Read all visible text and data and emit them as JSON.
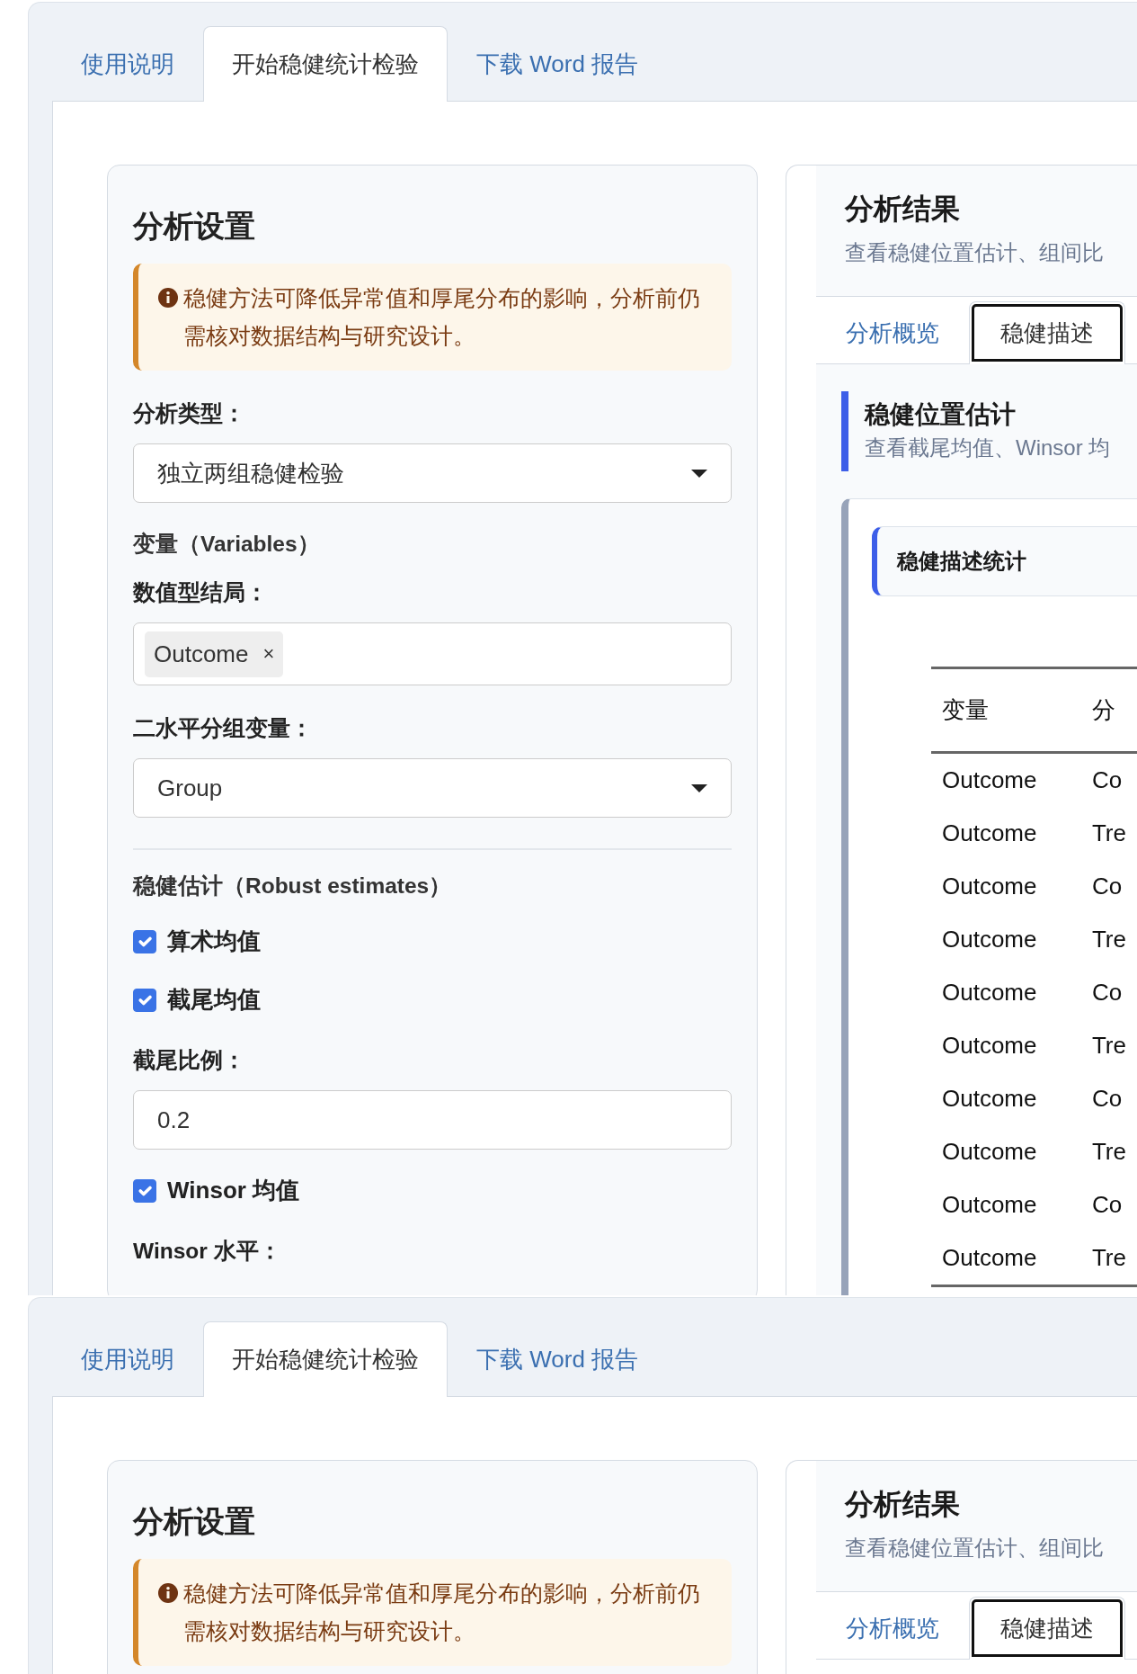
{
  "views": [
    {
      "tabs": [
        {
          "label": "使用说明",
          "selected": false
        },
        {
          "label": "开始稳健统计检验",
          "selected": true
        },
        {
          "label": "下载 Word 报告",
          "selected": false
        }
      ],
      "settings": {
        "title": "分析设置",
        "alert": "稳健方法可降低异常值和厚尾分布的影响，分析前仍需核对数据结构与研究设计。",
        "fields": [
          {
            "kind": "select",
            "label": "分析类型：",
            "value": "独立两组稳健检验"
          },
          {
            "kind": "heading",
            "label": "变量（Variables）",
            "rule_above": false
          },
          {
            "kind": "multiselect",
            "label": "数值型结局：",
            "chips": [
              {
                "label": "Outcome",
                "remove": "×"
              }
            ]
          },
          {
            "kind": "select",
            "label": "二水平分组变量：",
            "value": "Group"
          },
          {
            "kind": "heading",
            "label": "稳健估计（Robust estimates）",
            "rule_above": true
          },
          {
            "kind": "checkbox",
            "label": "算术均值",
            "checked": true
          },
          {
            "kind": "checkbox",
            "label": "截尾均值",
            "checked": true
          },
          {
            "kind": "input",
            "label": "截尾比例：",
            "value": "0.2"
          },
          {
            "kind": "checkbox",
            "label": "Winsor 均值",
            "checked": true
          },
          {
            "kind": "label",
            "label": "Winsor 水平："
          }
        ]
      },
      "results": {
        "title": "分析结果",
        "subtitle": "查看稳健位置估计、组间比",
        "tabs": [
          {
            "label": "分析概览",
            "selected": false
          },
          {
            "label": "稳健描述",
            "selected": true
          }
        ],
        "section": {
          "title": "稳健位置估计",
          "subtitle": "查看截尾均值、Winsor 均"
        },
        "panel": {
          "title": "稳健描述统计",
          "table": {
            "columns": [
              "变量",
              "分"
            ],
            "rows": [
              [
                "Outcome",
                "Co"
              ],
              [
                "Outcome",
                "Tre"
              ],
              [
                "Outcome",
                "Co"
              ],
              [
                "Outcome",
                "Tre"
              ],
              [
                "Outcome",
                "Co"
              ],
              [
                "Outcome",
                "Tre"
              ],
              [
                "Outcome",
                "Co"
              ],
              [
                "Outcome",
                "Tre"
              ],
              [
                "Outcome",
                "Co"
              ],
              [
                "Outcome",
                "Tre"
              ]
            ]
          }
        }
      }
    },
    {
      "tabs": [
        {
          "label": "使用说明",
          "selected": false
        },
        {
          "label": "开始稳健统计检验",
          "selected": true
        },
        {
          "label": "下载 Word 报告",
          "selected": false
        }
      ],
      "settings": {
        "title": "分析设置",
        "alert": "稳健方法可降低异常值和厚尾分布的影响，分析前仍需核对数据结构与研究设计。"
      },
      "results": {
        "title": "分析结果",
        "subtitle": "查看稳健位置估计、组间比",
        "tabs": [
          {
            "label": "分析概览",
            "selected": false
          },
          {
            "label": "稳健描述",
            "selected": true
          }
        ]
      }
    }
  ]
}
